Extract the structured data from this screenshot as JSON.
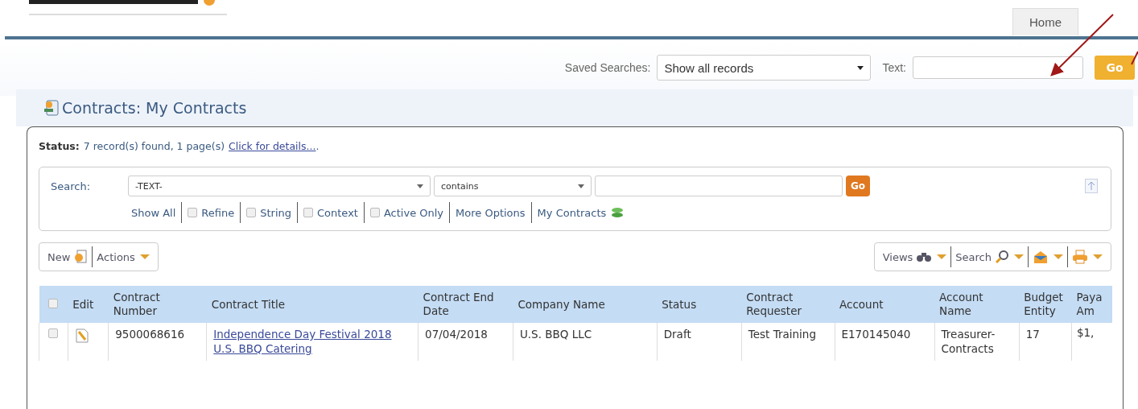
{
  "nav_tabs": [
    {
      "label": "Home",
      "selected": true
    }
  ],
  "saved_searches": {
    "label": "Saved Searches:",
    "value": "Show all records",
    "text_label": "Text:",
    "go": "Go"
  },
  "page_title": "Contracts: My Contracts",
  "status": {
    "label": "Status:",
    "text": "7 record(s) found, 1 page(s)",
    "link": "Click for details...",
    "end": "."
  },
  "search": {
    "label": "Search:",
    "field": "-TEXT-",
    "operator": "contains",
    "go": "Go",
    "options": [
      {
        "kind": "link",
        "label": "Show All"
      },
      {
        "kind": "checkbox",
        "label": "Refine",
        "checked": false
      },
      {
        "kind": "checkbox",
        "label": "String",
        "checked": false
      },
      {
        "kind": "checkbox",
        "label": "Context",
        "checked": false
      },
      {
        "kind": "checkbox",
        "label": "Active Only",
        "checked": false
      },
      {
        "kind": "link",
        "label": "More Options"
      },
      {
        "kind": "refresh",
        "label": "My Contracts"
      }
    ]
  },
  "toolbar_left": [
    {
      "label": "New"
    },
    {
      "label": "Actions"
    }
  ],
  "toolbar_right": [
    {
      "label": "Views"
    },
    {
      "label": "Search"
    }
  ],
  "table": {
    "edit_header": "Edit",
    "columns": [
      "Contract Number",
      "Contract Title",
      "Contract End Date",
      "Company Name",
      "Status",
      "Contract Requester",
      "Account",
      "Account Name",
      "Budget Entity",
      "Paya Am"
    ],
    "all_selected": false,
    "rows": [
      {
        "selected": false,
        "cells": [
          "9500068616",
          "Independence Day Festival 2018 U.S. BBQ Catering",
          "07/04/2018",
          "U.S. BBQ LLC",
          "Draft",
          "Test Training",
          "E170145040",
          "Treasurer-Contracts",
          "17",
          "$1,"
        ]
      }
    ]
  }
}
